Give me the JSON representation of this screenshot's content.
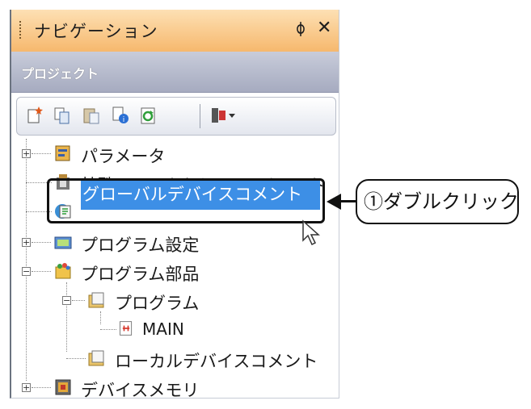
{
  "navigation": {
    "title": "ナビゲーション",
    "pin_glyph": "ᛰ",
    "close_glyph": "✕"
  },
  "project": {
    "title": "プロジェクト"
  },
  "toolbar": {
    "icons": [
      "new-item-icon",
      "copy-icon",
      "paste-icon",
      "properties-icon",
      "refresh-icon",
      "filter-icon"
    ]
  },
  "tree": {
    "items": [
      {
        "label": "パラメータ",
        "expander": "+"
      },
      {
        "label": "特殊ユニット(インテリジェント"
      },
      {
        "label": "グローバルデバイスコメント",
        "selected": true
      },
      {
        "label": "プログラム設定",
        "expander": "+"
      },
      {
        "label": "プログラム部品",
        "expander": "−"
      },
      {
        "label": "プログラム",
        "expander": "−"
      },
      {
        "label": "MAIN"
      },
      {
        "label": "ローカルデバイスコメント"
      },
      {
        "label": "デバイスメモリ",
        "expander": "+"
      }
    ]
  },
  "callout": {
    "text": "①ダブルクリック"
  },
  "colors": {
    "header_orange": "#f6b86d",
    "selection_blue": "#3d8fe6"
  }
}
